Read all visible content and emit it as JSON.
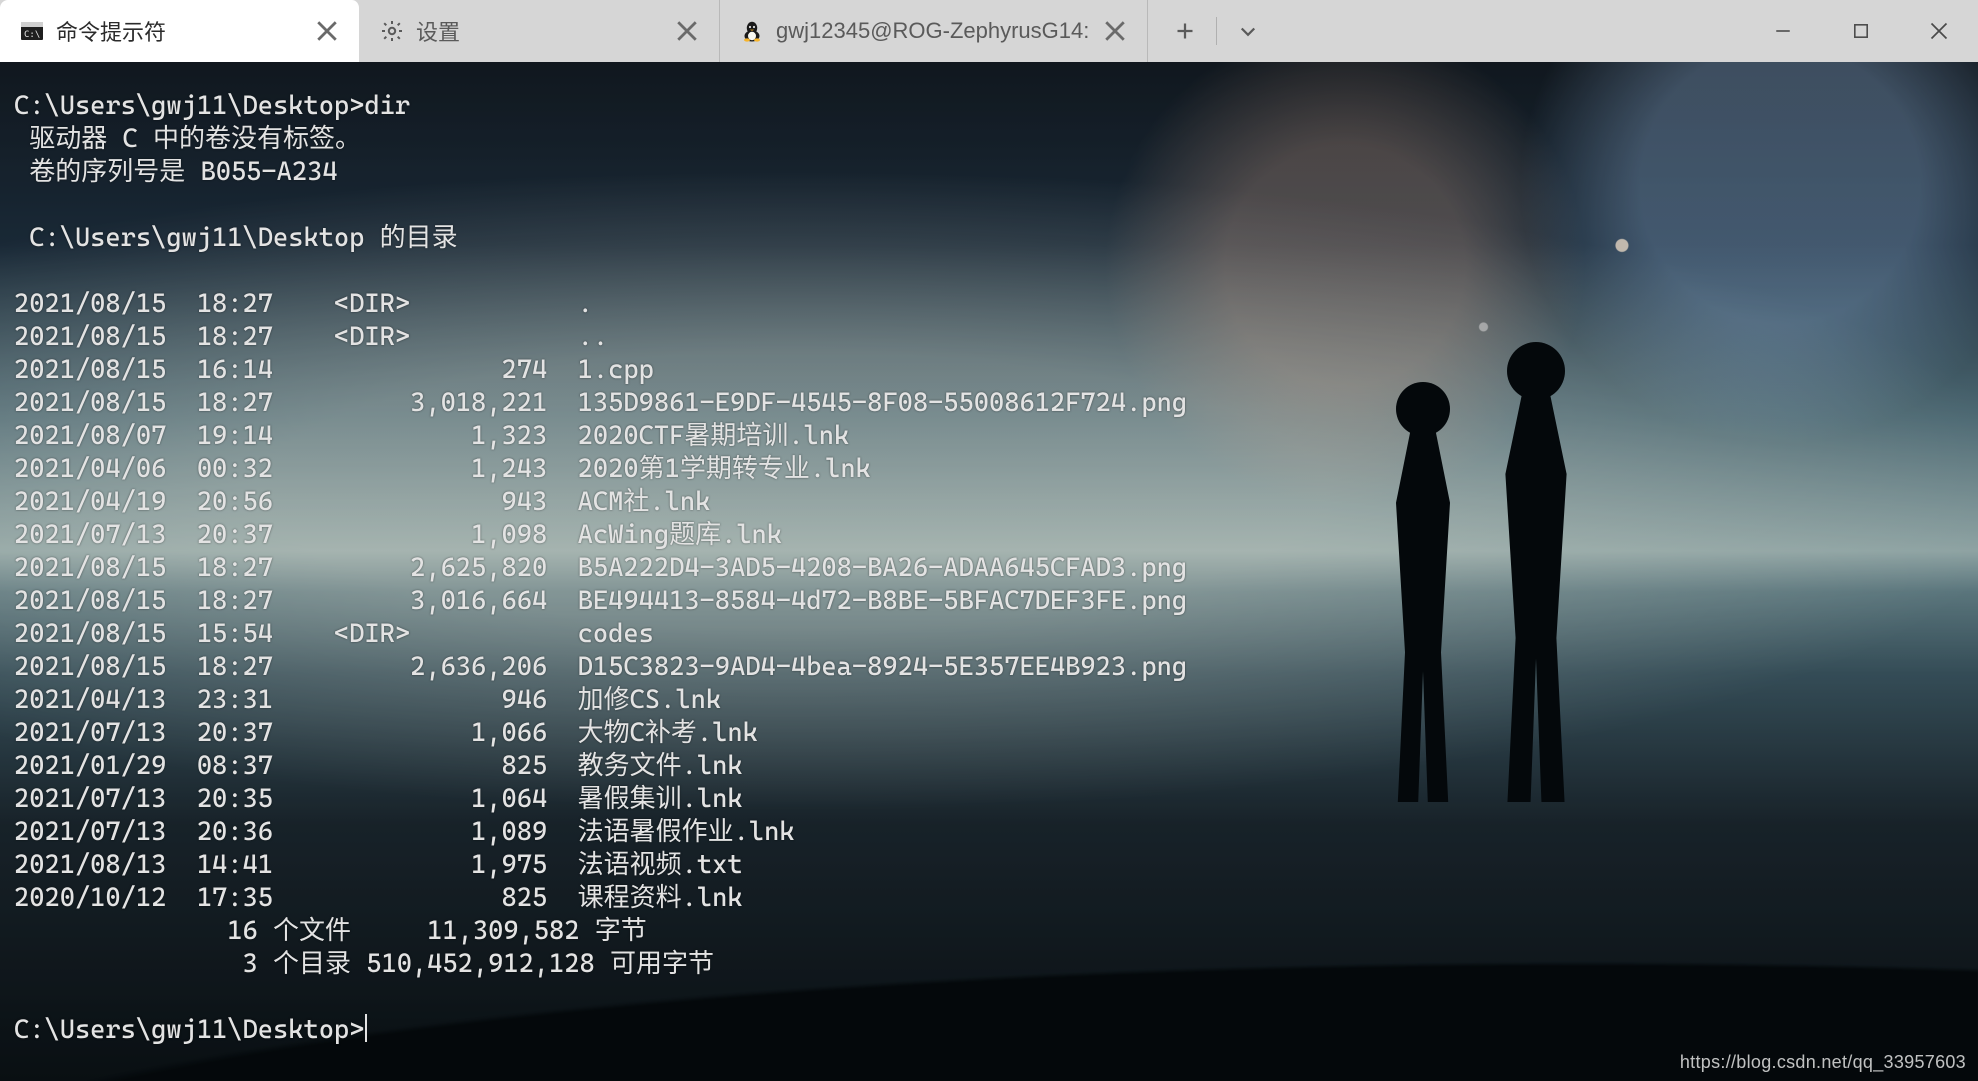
{
  "tabs": [
    {
      "icon": "cmd",
      "label": "命令提示符",
      "active": true
    },
    {
      "icon": "settings",
      "label": "设置",
      "active": false
    },
    {
      "icon": "tux",
      "label": "gwj12345@ROG-ZephyrusG14:",
      "active": false
    }
  ],
  "terminal": {
    "prompt_line": "C:\\Users\\gwj11\\Desktop>dir",
    "header1": " 驱动器 C 中的卷没有标签。",
    "header2": " 卷的序列号是 B055-A234",
    "dir_of": " C:\\Users\\gwj11\\Desktop 的目录",
    "entries": [
      {
        "date": "2021/08/15",
        "time": "18:27",
        "dir": true,
        "size": "",
        "name": "."
      },
      {
        "date": "2021/08/15",
        "time": "18:27",
        "dir": true,
        "size": "",
        "name": ".."
      },
      {
        "date": "2021/08/15",
        "time": "16:14",
        "dir": false,
        "size": "274",
        "name": "1.cpp"
      },
      {
        "date": "2021/08/15",
        "time": "18:27",
        "dir": false,
        "size": "3,018,221",
        "name": "135D9861-E9DF-4545-8F08-55008612F724.png"
      },
      {
        "date": "2021/08/07",
        "time": "19:14",
        "dir": false,
        "size": "1,323",
        "name": "2020CTF暑期培训.lnk"
      },
      {
        "date": "2021/04/06",
        "time": "00:32",
        "dir": false,
        "size": "1,243",
        "name": "2020第1学期转专业.lnk"
      },
      {
        "date": "2021/04/19",
        "time": "20:56",
        "dir": false,
        "size": "943",
        "name": "ACM社.lnk"
      },
      {
        "date": "2021/07/13",
        "time": "20:37",
        "dir": false,
        "size": "1,098",
        "name": "AcWing题库.lnk"
      },
      {
        "date": "2021/08/15",
        "time": "18:27",
        "dir": false,
        "size": "2,625,820",
        "name": "B5A222D4-3AD5-4208-BA26-ADAA645CFAD3.png"
      },
      {
        "date": "2021/08/15",
        "time": "18:27",
        "dir": false,
        "size": "3,016,664",
        "name": "BE494413-8584-4d72-B8BE-5BFAC7DEF3FE.png"
      },
      {
        "date": "2021/08/15",
        "time": "15:54",
        "dir": true,
        "size": "",
        "name": "codes"
      },
      {
        "date": "2021/08/15",
        "time": "18:27",
        "dir": false,
        "size": "2,636,206",
        "name": "D15C3823-9AD4-4bea-8924-5E357EE4B923.png"
      },
      {
        "date": "2021/04/13",
        "time": "23:31",
        "dir": false,
        "size": "946",
        "name": "加修CS.lnk"
      },
      {
        "date": "2021/07/13",
        "time": "20:37",
        "dir": false,
        "size": "1,066",
        "name": "大物C补考.lnk"
      },
      {
        "date": "2021/01/29",
        "time": "08:37",
        "dir": false,
        "size": "825",
        "name": "教务文件.lnk"
      },
      {
        "date": "2021/07/13",
        "time": "20:35",
        "dir": false,
        "size": "1,064",
        "name": "暑假集训.lnk"
      },
      {
        "date": "2021/07/13",
        "time": "20:36",
        "dir": false,
        "size": "1,089",
        "name": "法语暑假作业.lnk"
      },
      {
        "date": "2021/08/13",
        "time": "14:41",
        "dir": false,
        "size": "1,975",
        "name": "法语视频.txt"
      },
      {
        "date": "2020/10/12",
        "time": "17:35",
        "dir": false,
        "size": "825",
        "name": "课程资料.lnk"
      }
    ],
    "summary_files": "              16 个文件     11,309,582 字节",
    "summary_dirs": "               3 个目录 510,452,912,128 可用字节",
    "prompt2": "C:\\Users\\gwj11\\Desktop>"
  },
  "watermark": "https://blog.csdn.net/qq_33957603"
}
